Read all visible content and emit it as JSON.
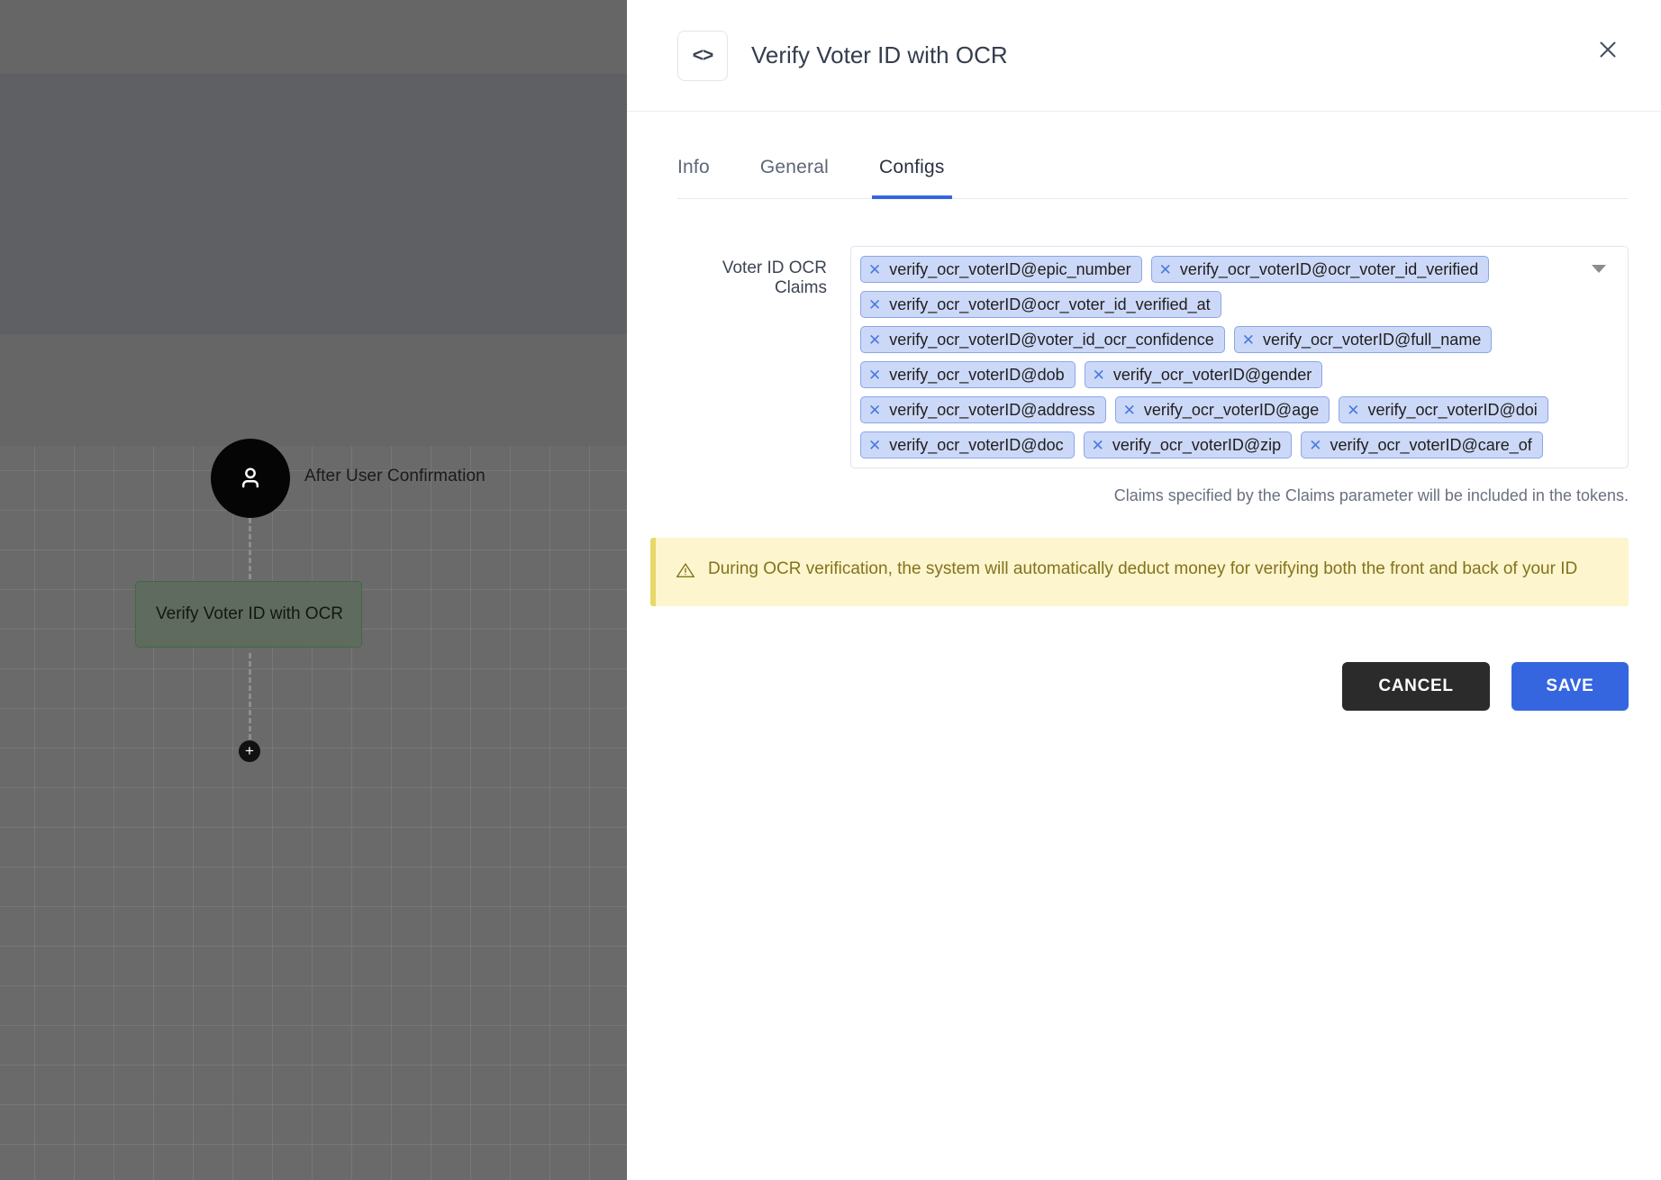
{
  "canvas": {
    "user_node": {
      "icon": "person-icon",
      "label": "After User Confirmation"
    },
    "flow_node": {
      "label": "Verify Voter ID with OCR"
    },
    "add_button": {
      "icon": "plus-icon",
      "label": "+"
    }
  },
  "drawer": {
    "header": {
      "icon": "code-brackets-icon",
      "icon_glyph": "<>",
      "title": "Verify Voter ID with OCR",
      "close_icon": "close-icon"
    },
    "tabs": [
      {
        "label": "Info",
        "active": false
      },
      {
        "label": "General",
        "active": false
      },
      {
        "label": "Configs",
        "active": true
      }
    ],
    "field": {
      "label": "Voter ID OCR Claims",
      "caret_icon": "chevron-down-icon",
      "helper_text": "Claims specified by the Claims parameter will be included in the tokens.",
      "chips": [
        "verify_ocr_voterID@epic_number",
        "verify_ocr_voterID@ocr_voter_id_verified",
        "verify_ocr_voterID@ocr_voter_id_verified_at",
        "verify_ocr_voterID@voter_id_ocr_confidence",
        "verify_ocr_voterID@full_name",
        "verify_ocr_voterID@dob",
        "verify_ocr_voterID@gender",
        "verify_ocr_voterID@address",
        "verify_ocr_voterID@age",
        "verify_ocr_voterID@doi",
        "verify_ocr_voterID@doc",
        "verify_ocr_voterID@zip",
        "verify_ocr_voterID@care_of"
      ],
      "chip_remove_glyph": "✕"
    },
    "alert": {
      "icon": "warning-triangle-icon",
      "text": "During OCR verification, the system will automatically deduct money for verifying both the front and back of your ID"
    },
    "footer": {
      "cancel_label": "CANCEL",
      "save_label": "SAVE"
    }
  },
  "colors": {
    "accent_blue": "#3566e0",
    "chip_bg": "#ccd8f7",
    "chip_border": "#8aa7e8",
    "alert_bg": "#fcf5cd",
    "alert_border": "#e8d86a",
    "alert_text": "#83731d",
    "cancel_bg": "#2b2b2b",
    "node_green": "#5f6b5f"
  }
}
